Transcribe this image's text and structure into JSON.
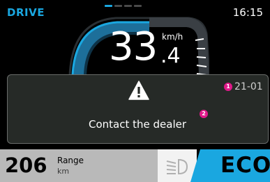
{
  "status_bar": {
    "mode": "DRIVE",
    "time": "16:15",
    "pager": {
      "pages": 4,
      "active_index": 0
    }
  },
  "speed": {
    "integer": "33",
    "decimal": ".4",
    "unit": "km/h"
  },
  "alert": {
    "icon": "warning-triangle-icon",
    "code": "21-01",
    "message": "Contact the dealer",
    "badge_code": "1",
    "badge_message": "2"
  },
  "bottom_bar": {
    "range_value": "206",
    "range_label": "Range",
    "range_unit": "km",
    "headlight_icon": "low-beam-headlight-icon",
    "drive_mode": "ECO"
  },
  "colors": {
    "accent": "#1aa7e0",
    "badge": "#e0198a",
    "alert_background": "#262a27",
    "range_panel": "#b9b9b9",
    "eco_panel": "#1aa7e0"
  }
}
